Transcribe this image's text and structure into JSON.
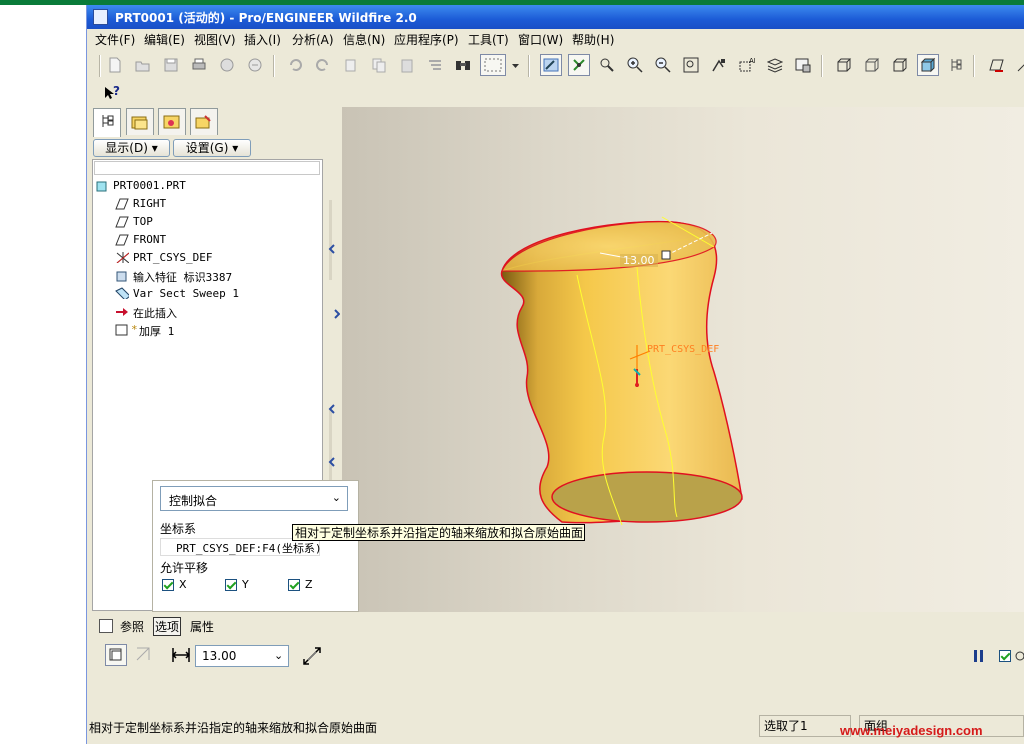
{
  "window": {
    "title": "PRT0001 (活动的) - Pro/ENGINEER Wildfire 2.0"
  },
  "menu": [
    "文件(F)",
    "编辑(E)",
    "视图(V)",
    "插入(I)",
    "分析(A)",
    "信息(N)",
    "应用程序(P)",
    "工具(T)",
    "窗口(W)",
    "帮助(H)"
  ],
  "toolbar": {
    "icons": [
      "new-icon",
      "open-icon",
      "save-icon",
      "print-icon",
      "send-icon",
      "regenerate-icon",
      "undo-icon",
      "redo-icon",
      "cut-icon",
      "copy-icon",
      "paste-icon",
      "paste-special-icon",
      "find-icon",
      "select-box-icon",
      "dropdown-arrow-icon",
      "repaint-icon",
      "spin-center-icon",
      "orient-icon",
      "zoom-in-icon",
      "zoom-out-icon",
      "refit-icon",
      "view-manager-icon",
      "saved-views-icon",
      "layers-icon",
      "view-manager2-icon",
      "wireframe-icon",
      "hidden-line-icon",
      "no-hidden-icon",
      "shading-icon",
      "model-tree-icon",
      "datum-plane-icon"
    ],
    "help": "?"
  },
  "navigator": {
    "show_label": "显示(D)",
    "settings_label": "设置(G)",
    "tree": [
      {
        "label": "PRT0001.PRT",
        "icon": "part-icon"
      },
      {
        "label": "RIGHT",
        "icon": "datum-plane-icon"
      },
      {
        "label": "TOP",
        "icon": "datum-plane-icon"
      },
      {
        "label": "FRONT",
        "icon": "datum-plane-icon"
      },
      {
        "label": "PRT_CSYS_DEF",
        "icon": "csys-icon"
      },
      {
        "label": "输入特征 标识3387",
        "icon": "import-feature-icon"
      },
      {
        "label": "Var Sect Sweep 1",
        "icon": "sweep-icon"
      },
      {
        "label": "在此插入",
        "icon": "insert-here-arrow-icon"
      },
      {
        "label": "加厚 1",
        "icon": "thicken-icon"
      }
    ]
  },
  "viewport": {
    "dimension_value": "13.00",
    "csys_label": "PRT_CSYS_DEF"
  },
  "options_panel": {
    "fit_option": "控制拟合",
    "csys_label": "坐标系",
    "csys_value": "PRT_CSYS_DEF:F4(坐标系)",
    "translation_label": "允许平移",
    "axes": [
      {
        "label": "X",
        "checked": true
      },
      {
        "label": "Y",
        "checked": true
      },
      {
        "label": "Z",
        "checked": true
      }
    ]
  },
  "tooltip": "相对于定制坐标系并沿指定的轴来缩放和拟合原始曲面",
  "dashboard": {
    "tabs": [
      "参照",
      "选项",
      "属性"
    ],
    "thickness_value": "13.00"
  },
  "status": {
    "message": "相对于定制坐标系并沿指定的轴来缩放和拟合原始曲面",
    "selected": "选取了1",
    "filter": "面组"
  },
  "watermark": "www.meiyadesign.com"
}
